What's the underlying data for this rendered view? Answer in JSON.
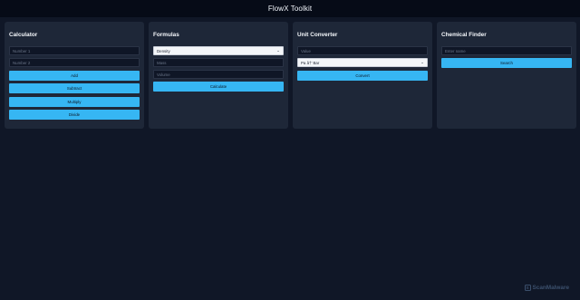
{
  "app": {
    "title": "FlowX Toolkit"
  },
  "calculator": {
    "title": "Calculator",
    "number1_placeholder": "Number 1",
    "number2_placeholder": "Number 2",
    "add_label": "Add",
    "subtract_label": "Subtract",
    "multiply_label": "Multiply",
    "divide_label": "Divide"
  },
  "formulas": {
    "title": "Formulas",
    "selected_formula": "Density",
    "mass_placeholder": "Mass",
    "volume_placeholder": "Volume",
    "calculate_label": "Calculate"
  },
  "unit_converter": {
    "title": "Unit Converter",
    "value_placeholder": "Value",
    "selected_conversion": "Pa â†’ Bar",
    "convert_label": "Convert"
  },
  "chemical_finder": {
    "title": "Chemical Finder",
    "name_placeholder": "Enter name",
    "search_label": "Search"
  },
  "watermark": {
    "text": "ScanMalware",
    "icon": "scanmalware-logo-icon"
  },
  "colors": {
    "background": "#101727",
    "topbar": "#060b17",
    "panel": "#1e2738",
    "accent": "#36b6f3"
  }
}
